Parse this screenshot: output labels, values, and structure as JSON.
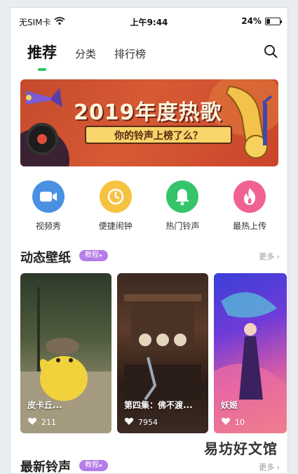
{
  "status_bar": {
    "carrier": "无SIM卡",
    "time": "上午9:44",
    "battery": "24%",
    "battery_level": 0.24
  },
  "tabs": [
    {
      "label": "推荐",
      "active": true
    },
    {
      "label": "分类",
      "active": false
    },
    {
      "label": "排行榜",
      "active": false
    }
  ],
  "banner": {
    "title": "2019年度热歌",
    "subtitle": "你的铃声上榜了么？"
  },
  "quick_actions": [
    {
      "label": "视频秀",
      "icon": "video-icon",
      "color": "#4a90e2"
    },
    {
      "label": "便捷闹钟",
      "icon": "clock-icon",
      "color": "#f5c242"
    },
    {
      "label": "热门铃声",
      "icon": "bell-icon",
      "color": "#35c46a"
    },
    {
      "label": "最热上传",
      "icon": "flame-icon",
      "color": "#f06292"
    }
  ],
  "wallpaper_section": {
    "title": "动态壁纸",
    "badge": "教程",
    "more": "更多",
    "cards": [
      {
        "caption": "皮卡丘...",
        "likes": "211"
      },
      {
        "caption": "第四集：佛不渡...",
        "likes": "7954"
      },
      {
        "caption": "妖姬",
        "likes": "10"
      }
    ]
  },
  "ringtone_section": {
    "title": "最新铃声",
    "badge": "教程",
    "more": "更多"
  },
  "watermark": "易坊好文馆",
  "colors": {
    "accent": "#2fc66a",
    "badge": "#b47de8"
  }
}
